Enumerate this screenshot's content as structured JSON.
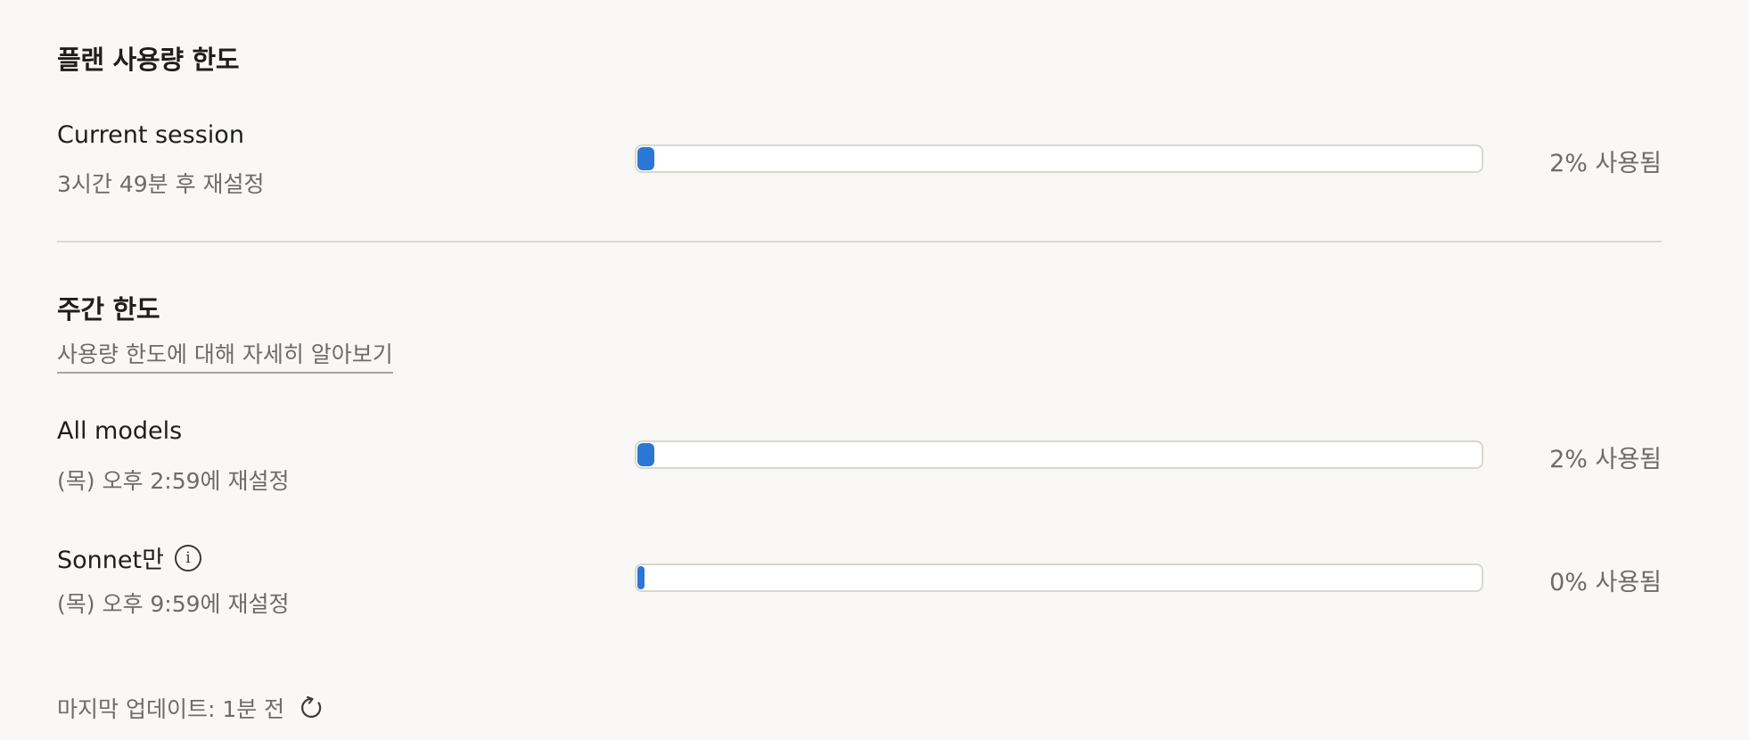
{
  "plan_limits": {
    "title": "플랜 사용량 한도",
    "current_session": {
      "label": "Current session",
      "reset_text": "3시간 49분 후 재설정",
      "usage_percent": 2,
      "usage_text": "2% 사용됨"
    }
  },
  "weekly_limits": {
    "title": "주간 한도",
    "learn_more_link": "사용량 한도에 대해 자세히 알아보기",
    "all_models": {
      "label": "All models",
      "reset_text": "(목) 오후 2:59에 재설정",
      "usage_percent": 2,
      "usage_text": "2% 사용됨"
    },
    "sonnet_only": {
      "label": "Sonnet만",
      "info_icon": "info-icon",
      "reset_text": "(목) 오후 9:59에 재설정",
      "usage_percent": 0,
      "usage_text": "0% 사용됨"
    }
  },
  "footer": {
    "last_updated": "마지막 업데이트: 1분 전",
    "refresh_icon": "refresh-icon"
  },
  "colors": {
    "progress_fill": "#2a77d6",
    "background": "#f9f8f6"
  }
}
